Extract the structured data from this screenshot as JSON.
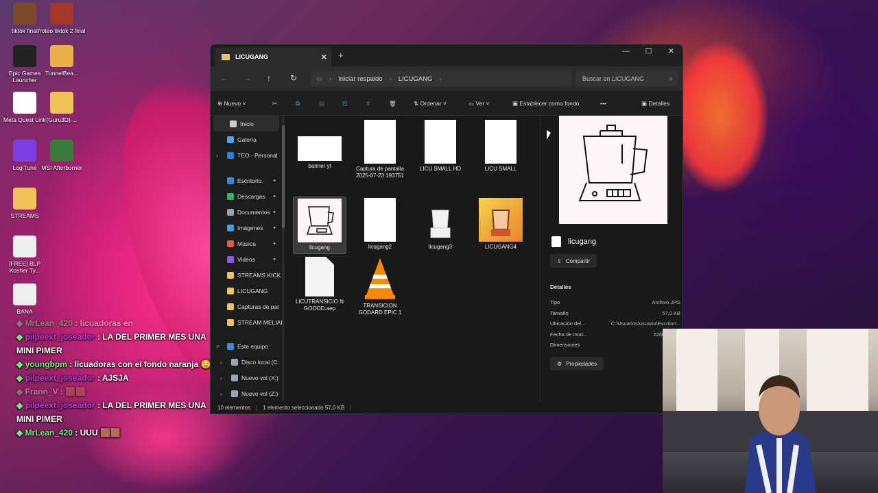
{
  "desktop": {
    "icons": [
      {
        "label": "tiktok final",
        "color": "#7a4a2a"
      },
      {
        "label": "froteo tiktok 2 final",
        "color": "#a3382a"
      },
      {
        "label": "Epic Games Launcher",
        "color": "#222222"
      },
      {
        "label": "TunnelBea...",
        "color": "#e8b04a"
      },
      {
        "label": "Meta Quest Link",
        "color": "#ffffff"
      },
      {
        "label": "[Guru3D]-...",
        "color": "#f0c25a"
      },
      {
        "label": "LogiTune",
        "color": "#7b3fe4"
      },
      {
        "label": "MSI Afterburner",
        "color": "#3a7a3a"
      },
      {
        "label": "STREAMS",
        "color": "#f0c25a"
      },
      {
        "label": "[FREE] BLP Kosher Ty...",
        "color": "#eeeeee"
      },
      {
        "label": "BANA",
        "color": "#eeeeee"
      }
    ]
  },
  "explorer": {
    "tab_title": "LICUGANG",
    "new_tab": "+",
    "breadcrumb": [
      "Iniciar respaldo",
      "LICUGANG"
    ],
    "search_placeholder": "Buscar en LICUGANG",
    "toolbar": {
      "new": "Nuevo",
      "sort": "Ordenar",
      "view": "Ver",
      "set_background": "Establecer como fondo",
      "more": "•••",
      "details": "Detalles"
    },
    "sidebar": [
      {
        "label": "Inicio",
        "color": "#cfcfcf",
        "pinned": false,
        "selected": true
      },
      {
        "label": "Galería",
        "color": "#4aa3f0",
        "pinned": false
      },
      {
        "label": "TEO - Personal",
        "color": "#2a7fe0",
        "pinned": false,
        "expand": true
      },
      {
        "label": "",
        "spacer": true
      },
      {
        "label": "Escritorio",
        "color": "#3a8ae0",
        "pinned": true
      },
      {
        "label": "Descargas",
        "color": "#2fb36a",
        "pinned": true
      },
      {
        "label": "Documentos",
        "color": "#9aa3b0",
        "pinned": true
      },
      {
        "label": "Imágenes",
        "color": "#3aa0e8",
        "pinned": true
      },
      {
        "label": "Música",
        "color": "#e85a3a",
        "pinned": true
      },
      {
        "label": "Videos",
        "color": "#8a5ae0",
        "pinned": true
      },
      {
        "label": "STREAMS KICK",
        "color": "#f0c25a",
        "pinned": false
      },
      {
        "label": "LICUGANG",
        "color": "#f0c25a",
        "pinned": false
      },
      {
        "label": "Capturas de par",
        "color": "#f0c25a",
        "pinned": false
      },
      {
        "label": "STREAM MELIAI",
        "color": "#f0c25a",
        "pinned": false
      },
      {
        "label": "",
        "spacer": true
      },
      {
        "label": "Este equipo",
        "color": "#3a8ae0",
        "pinned": false,
        "expanded": true
      },
      {
        "label": "Disco local (C:",
        "color": "#9aa3b0",
        "pinned": false,
        "child": true
      },
      {
        "label": "Nuevo vol (X:)",
        "color": "#9aa3b0",
        "pinned": false,
        "child": true
      },
      {
        "label": "Nuevo vol (Z:)",
        "color": "#9aa3b0",
        "pinned": false,
        "child": true
      }
    ],
    "files": [
      {
        "name": "banner yt",
        "kind": "wide"
      },
      {
        "name": "Captura de pantalla 2025-07-23 193751",
        "kind": "tall"
      },
      {
        "name": "LICU SMALL HD",
        "kind": "tall"
      },
      {
        "name": "LICU SMALL",
        "kind": "tall"
      },
      {
        "name": "licugang",
        "kind": "blender",
        "selected": true
      },
      {
        "name": "licugang2",
        "kind": "tall"
      },
      {
        "name": "licugang3",
        "kind": "blender-small"
      },
      {
        "name": "LICUGANG4",
        "kind": "orange"
      },
      {
        "name": "LICUTRANSICIO N GOOOD.aep",
        "kind": "doc"
      },
      {
        "name": "TRANSICION GODARD EPIC 1",
        "kind": "vlc"
      }
    ],
    "preview": {
      "file_name": "licugang",
      "share": "Compartir",
      "details_heading": "Detalles",
      "details": [
        {
          "label": "Tipo",
          "value": "Archivo JPG"
        },
        {
          "label": "Tamaño",
          "value": "57,0 KB"
        },
        {
          "label": "Ubicación del...",
          "value": "C:\\Usuarios\\usuario\\Escritori..."
        },
        {
          "label": "Fecha de mod...",
          "value": "22/8/2024 1"
        },
        {
          "label": "Dimensiones",
          "value": "1280 x"
        }
      ],
      "properties": "Propiedades"
    },
    "status": {
      "count": "10 elementos",
      "selection": "1 elemento seleccionado  57,0 KB"
    }
  },
  "chat": [
    {
      "user": "MrLean_420",
      "text": ": licuadoras en",
      "dim": true,
      "color": "#6cf07c"
    },
    {
      "user": "pilpeext_joseador",
      "text": ": LA DEL PRIMER MES UNA MINI PIMER",
      "dim": false,
      "color": "#c43be0"
    },
    {
      "user": "youngbpm",
      "text": ": licuadoras con el fondo naranja 🤤",
      "dim": false,
      "color": "#6cf07c"
    },
    {
      "user": "pilpeext_joseador",
      "text": ": AJSJA",
      "dim": false,
      "color": "#c43be0"
    },
    {
      "user": "Frann_V",
      "text": ": 🟫🟫",
      "dim": true,
      "color": "#e0e0e0"
    },
    {
      "user": "pilpeext_joseador",
      "text": ": LA DEL PRIMER MES UNA MINI PIMER",
      "dim": false,
      "color": "#c43be0"
    },
    {
      "user": "MrLean_420",
      "text": ": UUU 🟫🟫",
      "dim": false,
      "color": "#6cf07c"
    }
  ]
}
